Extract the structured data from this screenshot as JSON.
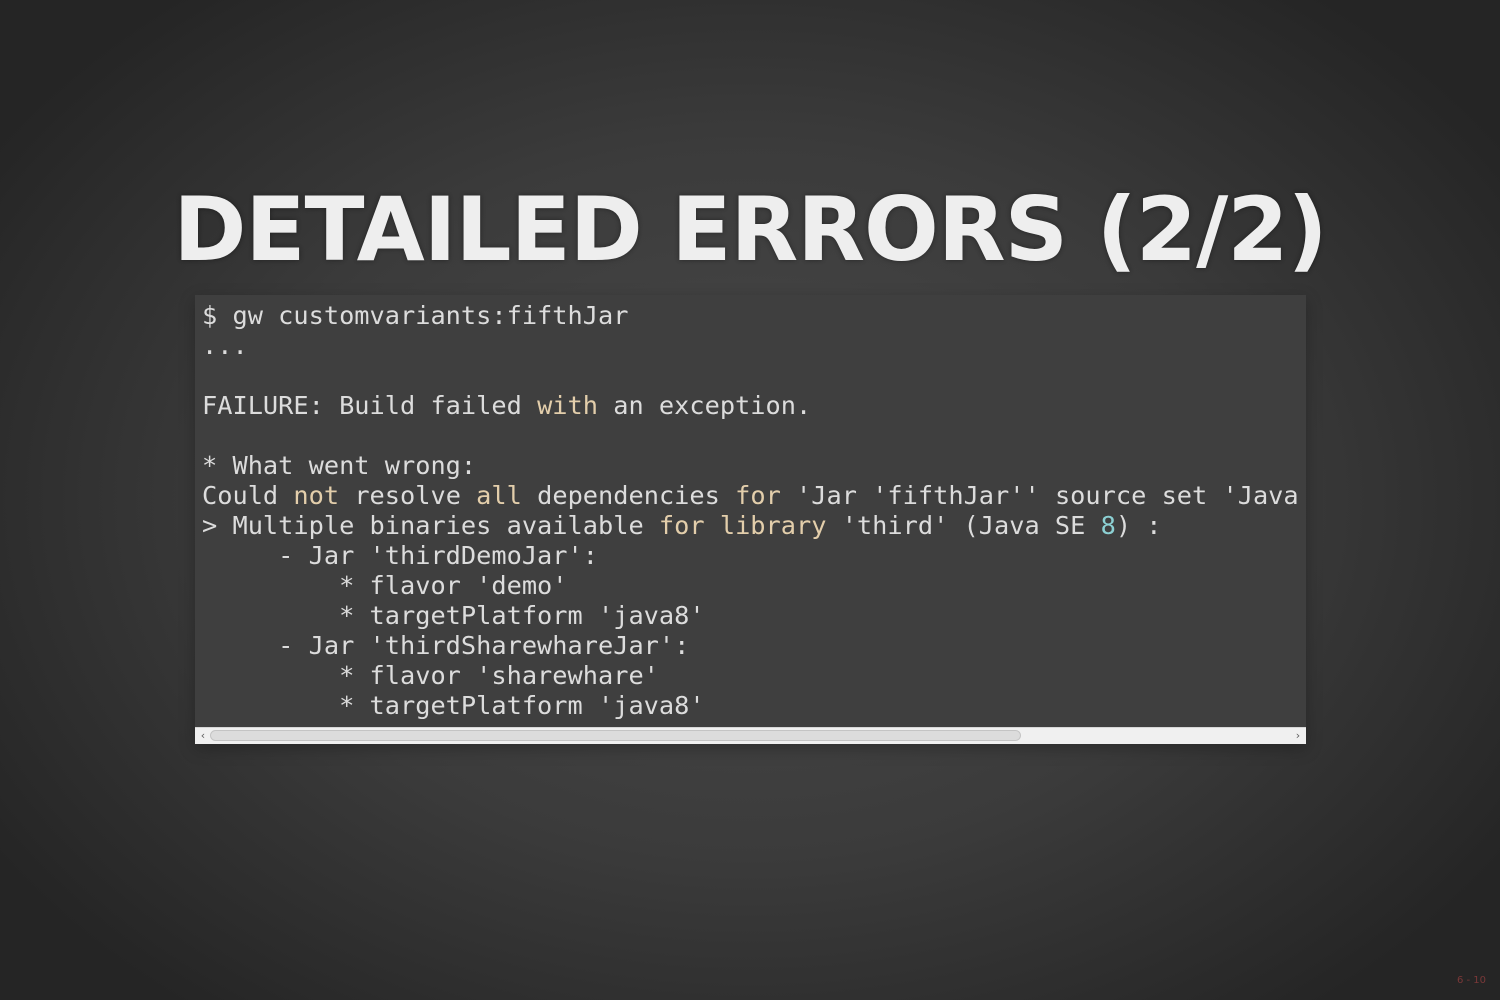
{
  "slide": {
    "title": "DETAILED ERRORS (2/2)",
    "number": "6 - 10"
  },
  "code": {
    "language": "console",
    "lines": [
      [
        {
          "t": "$ gw customvariants:fifthJar",
          "c": "plain"
        }
      ],
      [
        {
          "t": "...",
          "c": "plain"
        }
      ],
      [],
      [
        {
          "t": "FAILURE: Build failed ",
          "c": "plain"
        },
        {
          "t": "with",
          "c": "kw"
        },
        {
          "t": " an exception.",
          "c": "plain"
        }
      ],
      [],
      [
        {
          "t": "* What went wrong:",
          "c": "plain"
        }
      ],
      [
        {
          "t": "Could ",
          "c": "plain"
        },
        {
          "t": "not",
          "c": "kw"
        },
        {
          "t": " resolve ",
          "c": "plain"
        },
        {
          "t": "all",
          "c": "kw"
        },
        {
          "t": " dependencies ",
          "c": "plain"
        },
        {
          "t": "for",
          "c": "kw"
        },
        {
          "t": " 'Jar 'fifthJar'' source set 'Java",
          "c": "plain"
        }
      ],
      [
        {
          "t": "> Multiple binaries available ",
          "c": "plain"
        },
        {
          "t": "for",
          "c": "kw"
        },
        {
          "t": " ",
          "c": "plain"
        },
        {
          "t": "library",
          "c": "kw"
        },
        {
          "t": " 'third' (Java SE ",
          "c": "plain"
        },
        {
          "t": "8",
          "c": "num"
        },
        {
          "t": ") :",
          "c": "plain"
        }
      ],
      [
        {
          "t": "     - Jar 'thirdDemoJar':",
          "c": "plain"
        }
      ],
      [
        {
          "t": "         * flavor 'demo'",
          "c": "plain"
        }
      ],
      [
        {
          "t": "         * targetPlatform 'java8'",
          "c": "plain"
        }
      ],
      [
        {
          "t": "     - Jar 'thirdSharewhareJar':",
          "c": "plain"
        }
      ],
      [
        {
          "t": "         * flavor 'sharewhare'",
          "c": "plain"
        }
      ],
      [
        {
          "t": "         * targetPlatform 'java8'",
          "c": "plain"
        }
      ]
    ]
  },
  "scrollbar": {
    "left_arrow_icon": "chevron-left-icon",
    "right_arrow_icon": "chevron-right-icon",
    "thumb_fraction": 0.75,
    "scroll_position": 0
  },
  "colors": {
    "keyword": "#e3ceab",
    "number": "#8cd0d3",
    "text": "#dcdcdc",
    "panel_background": "#3f3f3f",
    "title": "#eeeeee"
  }
}
